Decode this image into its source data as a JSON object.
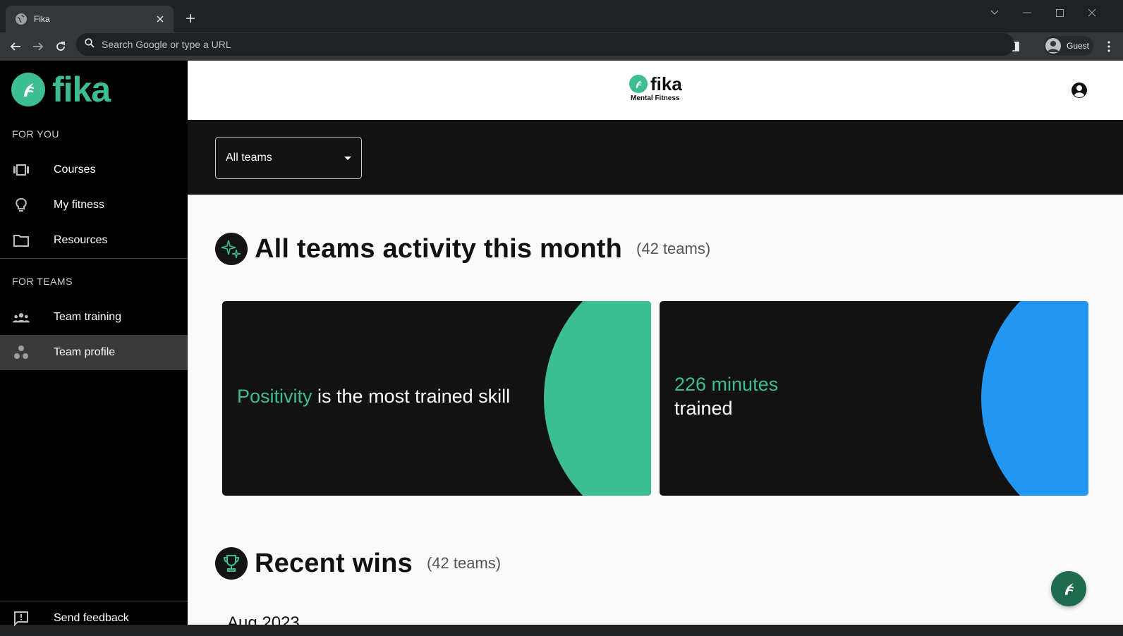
{
  "browser": {
    "tab_title": "Fika",
    "omnibox_placeholder": "Search Google or type a URL",
    "profile_label": "Guest"
  },
  "sidebar": {
    "brand": "fika",
    "for_you_label": "FOR YOU",
    "for_you_items": [
      {
        "label": "Courses",
        "icon": "courses-icon"
      },
      {
        "label": "My fitness",
        "icon": "bulb-icon"
      },
      {
        "label": "Resources",
        "icon": "folder-icon"
      }
    ],
    "for_teams_label": "FOR TEAMS",
    "for_teams_items": [
      {
        "label": "Team training",
        "icon": "group-icon"
      },
      {
        "label": "Team profile",
        "icon": "bubble-icon",
        "active": true
      }
    ],
    "feedback_label": "Send feedback"
  },
  "header": {
    "logo_word": "fika",
    "logo_sub": "Mental Fitness"
  },
  "filter": {
    "selected": "All teams"
  },
  "activity": {
    "title": "All teams activity this month",
    "count": "(42 teams)",
    "skill_card": {
      "highlight": "Positivity",
      "rest": " is the most trained skill",
      "color": "#3dbd92"
    },
    "minutes_card": {
      "highlight": "226 minutes",
      "rest": "trained",
      "color": "#2196f3"
    }
  },
  "wins": {
    "title": "Recent wins",
    "count": "(42 teams)",
    "month": "Aug 2023"
  },
  "colors": {
    "brand_green": "#3dbd92",
    "accent_blue": "#2196f3"
  }
}
